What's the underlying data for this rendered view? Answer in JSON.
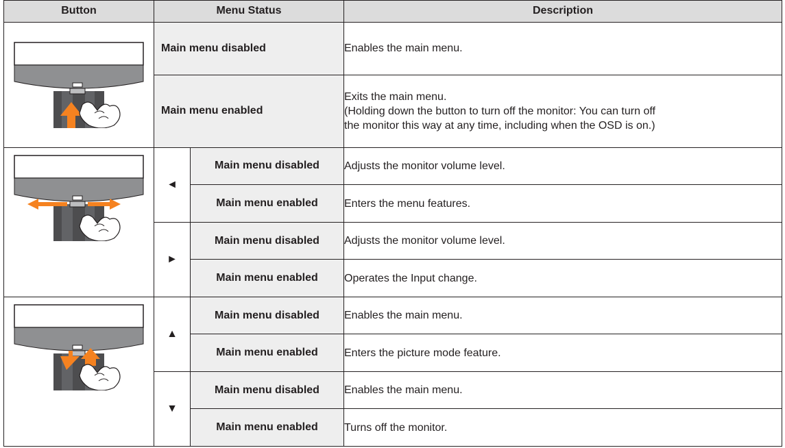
{
  "headers": {
    "button": "Button",
    "menu_status": "Menu Status",
    "description": "Description"
  },
  "group1": {
    "row1": {
      "status": "Main menu disabled",
      "desc": "Enables the main menu."
    },
    "row2": {
      "status": "Main menu enabled",
      "desc_line1": "Exits the main menu.",
      "desc_line2": "(Holding down the button to turn off the monitor: You can turn off",
      "desc_line3": "the monitor this way at any time, including when the OSD is on.)"
    }
  },
  "group2": {
    "left_arrow": "◄",
    "right_arrow": "►",
    "rows": [
      {
        "status": "Main menu disabled",
        "desc": "Adjusts the monitor volume level."
      },
      {
        "status": "Main menu enabled",
        "desc": "Enters the menu features."
      },
      {
        "status": "Main menu disabled",
        "desc": "Adjusts the monitor volume level."
      },
      {
        "status": "Main menu enabled",
        "desc": "Operates the Input change."
      }
    ]
  },
  "group3": {
    "up_arrow": "▲",
    "down_arrow": "▼",
    "rows": [
      {
        "status": "Main menu disabled",
        "desc": "Enables the main menu."
      },
      {
        "status": "Main menu enabled",
        "desc": "Enters the picture mode feature."
      },
      {
        "status": "Main menu disabled",
        "desc": "Enables the main menu."
      },
      {
        "status": "Main menu enabled",
        "desc": "Turns off the monitor."
      }
    ]
  },
  "colors": {
    "arrow_accent": "#f58220",
    "header_bg": "#dcdcdc",
    "status_bg": "#eeeeee",
    "monitor_bezel": "#8f9092"
  },
  "icons": [
    "monitor-press-up-illustration",
    "monitor-left-right-illustration",
    "monitor-up-down-illustration"
  ]
}
